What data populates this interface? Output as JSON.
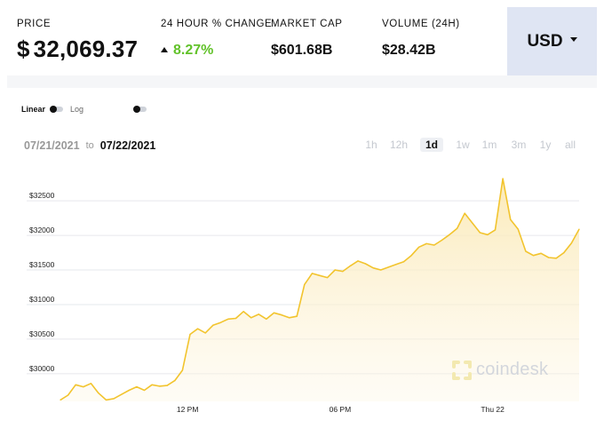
{
  "stats": {
    "price_label": "PRICE",
    "price_currency": "$",
    "price_value": "32,069.37",
    "change_label": "24 HOUR % CHANGE",
    "change_value": "8.27%",
    "market_cap_label": "MARKET CAP",
    "market_cap_value": "$601.68B",
    "volume_label": "VOLUME (24H)",
    "volume_value": "$28.42B"
  },
  "currency_selector": {
    "label": "USD"
  },
  "scale": {
    "linear_label": "Linear",
    "log_label": "Log"
  },
  "date_range": {
    "from": "07/21/2021",
    "to_word": "to",
    "to": "07/22/2021"
  },
  "ranges": [
    "1h",
    "12h",
    "1d",
    "1w",
    "1m",
    "3m",
    "1y",
    "all"
  ],
  "active_range": "1d",
  "watermark": "coindesk",
  "colors": {
    "line": "#f2c42e",
    "fill_top": "#fbe9b5",
    "positive": "#62c22a",
    "currency_bg": "#dfe5f3"
  },
  "chart_data": {
    "type": "area",
    "y_ticks": [
      30000,
      30500,
      31000,
      31500,
      32000,
      32500
    ],
    "y_tick_labels": [
      "$30000",
      "$30500",
      "$31000",
      "$31500",
      "$32000",
      "$32500"
    ],
    "x_tick_labels": [
      "12 PM",
      "06 PM",
      "Thu 22"
    ],
    "x_tick_times": [
      12,
      18,
      24
    ],
    "x_range": [
      7.0,
      27.4
    ],
    "ylim": [
      29600,
      32900
    ],
    "grid": true,
    "series": [
      {
        "x": [
          7.0,
          7.3,
          7.6,
          7.9,
          8.2,
          8.5,
          8.8,
          9.1,
          9.4,
          9.7,
          10.0,
          10.3,
          10.6,
          10.9,
          11.2,
          11.5,
          11.8,
          12.1,
          12.4,
          12.7,
          13.0,
          13.3,
          13.6,
          13.9,
          14.2,
          14.5,
          14.8,
          15.1,
          15.4,
          15.7,
          16.0,
          16.3,
          16.6,
          16.9,
          17.2,
          17.5,
          17.8,
          18.1,
          18.4,
          18.7,
          19.0,
          19.3,
          19.6,
          19.9,
          20.2,
          20.5,
          20.8,
          21.1,
          21.4,
          21.7,
          22.0,
          22.3,
          22.6,
          22.9,
          23.2,
          23.5,
          23.8,
          24.1,
          24.4,
          24.7,
          25.0,
          25.3,
          25.6,
          25.9,
          26.2,
          26.5,
          26.8,
          27.1,
          27.4
        ],
        "values": [
          29620,
          29690,
          29840,
          29810,
          29860,
          29720,
          29620,
          29640,
          29700,
          29760,
          29810,
          29760,
          29840,
          29820,
          29830,
          29900,
          30050,
          30570,
          30650,
          30590,
          30700,
          30740,
          30790,
          30800,
          30900,
          30810,
          30860,
          30790,
          30880,
          30850,
          30810,
          30830,
          31290,
          31450,
          31420,
          31390,
          31500,
          31480,
          31560,
          31630,
          31590,
          31530,
          31500,
          31540,
          31580,
          31620,
          31710,
          31830,
          31880,
          31860,
          31930,
          32010,
          32100,
          32320,
          32180,
          32040,
          32010,
          32080,
          32820,
          32230,
          32090,
          31770,
          31710,
          31740,
          31680,
          31670,
          31750,
          31890,
          32090
        ]
      }
    ]
  }
}
